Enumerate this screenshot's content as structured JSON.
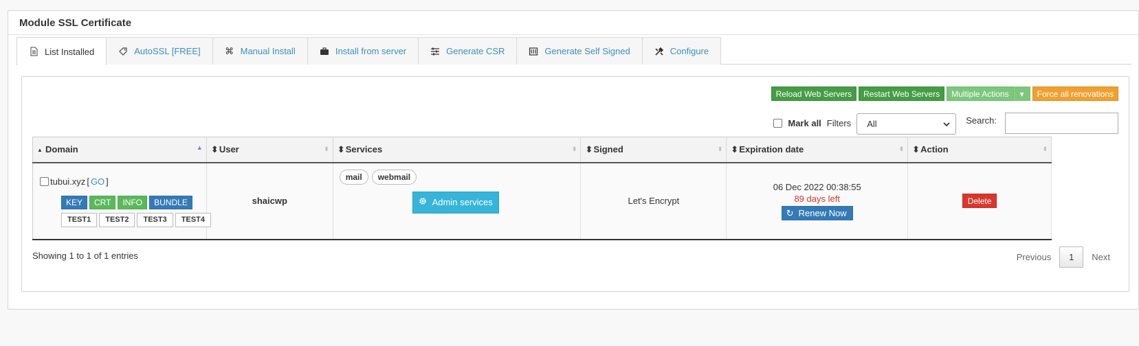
{
  "panel": {
    "title": "Module SSL Certificate"
  },
  "tabs": [
    {
      "label": "List Installed",
      "icon": "document-icon"
    },
    {
      "label": "AutoSSL [FREE]",
      "icon": "tag-icon"
    },
    {
      "label": "Manual Install",
      "icon": "command-icon"
    },
    {
      "label": "Install from server",
      "icon": "briefcase-icon"
    },
    {
      "label": "Generate CSR",
      "icon": "sliders-icon"
    },
    {
      "label": "Generate Self Signed",
      "icon": "certificate-icon"
    },
    {
      "label": "Configure",
      "icon": "tools-icon"
    }
  ],
  "toolbar": {
    "reload": "Reload Web Servers",
    "restart": "Restart Web Servers",
    "multiple": "Multiple Actions",
    "force": "Force all renovations"
  },
  "filters": {
    "mark_all": "Mark all",
    "filters_label": "Filters",
    "filter_value": "All",
    "search_label": "Search:"
  },
  "table": {
    "columns": [
      "Domain",
      "User",
      "Services",
      "Signed",
      "Expiration date",
      "Action"
    ],
    "row": {
      "domain": "tubui.xyz",
      "go_open": "[",
      "go": "GO",
      "go_close": "]",
      "tags1": [
        "KEY",
        "CRT",
        "INFO",
        "BUNDLE"
      ],
      "tags2": [
        "TEST1",
        "TEST2",
        "TEST3",
        "TEST4"
      ],
      "user": "shaicwp",
      "services": [
        "mail",
        "webmail"
      ],
      "admin_services": "Admin services",
      "signed": "Let's Encrypt",
      "expiration": "06 Dec 2022 00:38:55",
      "days_left": "89 days left",
      "renew": "Renew Now",
      "delete": "Delete"
    }
  },
  "footer": {
    "showing": "Showing 1 to 1 of 1 entries",
    "previous": "Previous",
    "page": "1",
    "next": "Next"
  }
}
